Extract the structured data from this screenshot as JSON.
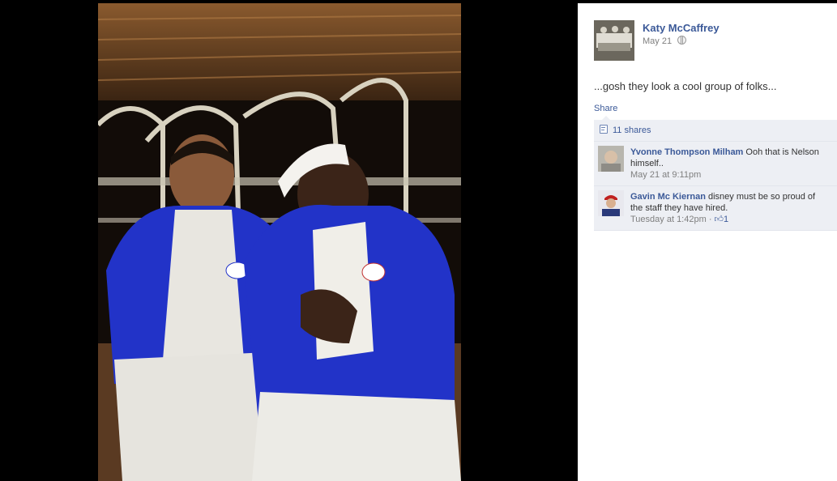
{
  "post": {
    "author": "Katy McCaffrey",
    "date": "May 21",
    "privacy_icon": "globe-icon",
    "text": "...gosh they look a cool group of folks...",
    "share_label": "Share"
  },
  "shares": {
    "label": "11 shares",
    "icon": "shares-icon"
  },
  "comments": [
    {
      "name": "Yvonne Thompson Milham",
      "text": "Ooh that is Nelson himself..",
      "time": "May 21 at 9:11pm"
    },
    {
      "name": "Gavin Mc Kiernan",
      "text": "disney must be so proud of the staff they have hired.",
      "time": "Tuesday at 1:42pm",
      "separator": " · ",
      "like_icon": "thumbs-up-icon",
      "likes": "1"
    }
  ],
  "colors": {
    "link": "#3b5998",
    "ufi_bg": "#edeff4",
    "jacket": "#2233c8"
  }
}
